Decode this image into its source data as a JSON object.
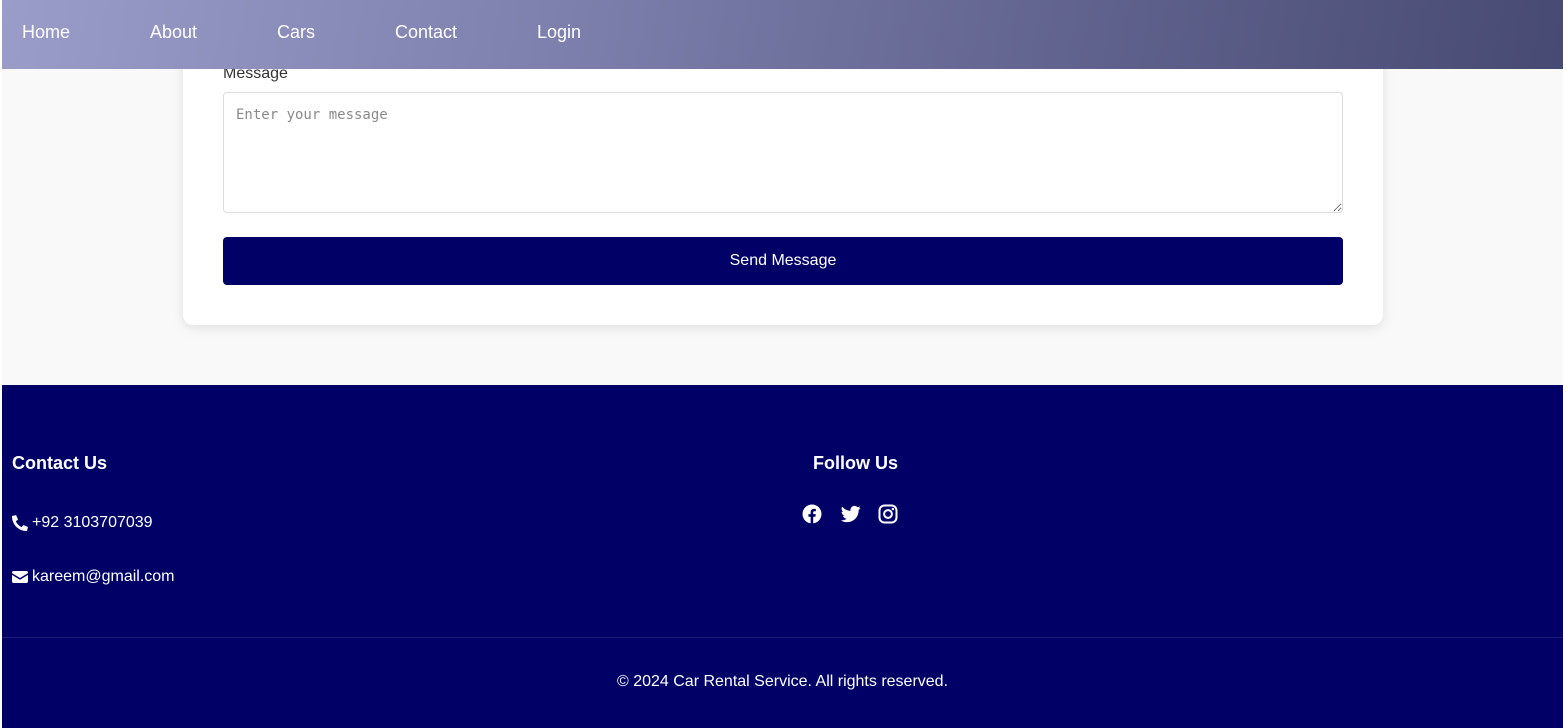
{
  "nav": {
    "items": [
      {
        "label": "Home"
      },
      {
        "label": "About"
      },
      {
        "label": "Cars"
      },
      {
        "label": "Contact"
      },
      {
        "label": "Login"
      }
    ]
  },
  "form": {
    "message_label": "Message",
    "message_placeholder": "Enter your message",
    "message_value": "",
    "submit_label": "Send Message"
  },
  "footer": {
    "contact": {
      "heading": "Contact Us",
      "phone": "+92 3103707039",
      "phone_icon": "phone-icon",
      "email": "kareem@gmail.com",
      "email_icon": "envelope-icon"
    },
    "follow": {
      "heading": "Follow Us",
      "icons": [
        "facebook-icon",
        "twitter-icon",
        "instagram-icon"
      ]
    },
    "copyright": "© 2024 Car Rental Service. All rights reserved."
  },
  "colors": {
    "primary": "#000066",
    "page_bg": "#f9f9f9",
    "card_bg": "#ffffff",
    "nav_gradient_start": "#9a9cc9",
    "nav_gradient_end": "#474a72",
    "text_on_dark": "#ffffff"
  }
}
